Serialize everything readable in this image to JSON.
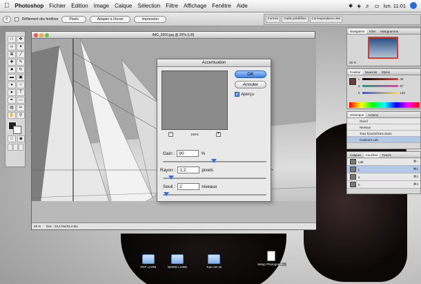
{
  "menubar": {
    "apple": "",
    "app": "Photoshop",
    "items": [
      "Fichier",
      "Edition",
      "Image",
      "Calque",
      "Sélection",
      "Filtre",
      "Affichage",
      "Fenêtre",
      "Aide"
    ],
    "clock": "lun. 11:01"
  },
  "options": {
    "scroll_all": "Défilement des fenêtres",
    "buttons": [
      "Pixels",
      "Adapter à l'écran",
      "Impression"
    ]
  },
  "palette_well": {
    "tabs": [
      "Formes",
      "Outils prédéfinis",
      "Correspondance des"
    ]
  },
  "document": {
    "title": "IMG_5550.jpg @ 25% (L/8)",
    "zoom": "25 %",
    "doc_info": "Doc : 23,4 Mo/23,4 Mo"
  },
  "dialog": {
    "title": "Accentuation",
    "ok": "OK",
    "cancel": "Annuler",
    "preview_check": "✓",
    "preview_label": "Aperçu",
    "preview_zoom": "100%",
    "minus": "−",
    "plus": "+",
    "amount_label": "Gain :",
    "amount_value": "90",
    "amount_unit": "%",
    "radius_label": "Rayon :",
    "radius_value": "1,2",
    "radius_unit": "pixels",
    "threshold_label": "Seuil :",
    "threshold_value": "2",
    "threshold_unit": "niveaux"
  },
  "navigator": {
    "tabs": [
      "Navigateur",
      "Infos",
      "Histogramme"
    ],
    "zoom": "25 %"
  },
  "color_panel": {
    "tabs": [
      "Couleur",
      "Nuancier",
      "Styles"
    ],
    "rows": [
      {
        "label": "L",
        "value": "45"
      },
      {
        "label": "a",
        "value": "87"
      },
      {
        "label": "b",
        "value": "140"
      }
    ]
  },
  "history": {
    "tabs": [
      "Historique",
      "Actions"
    ],
    "items": [
      "Ouvrir",
      "Niveaux",
      "Tons foncés/Tons clairs",
      "Couleurs Lab"
    ]
  },
  "layers": {
    "tabs": [
      "Calques",
      "Couches",
      "Tracés"
    ],
    "items": [
      {
        "name": "Lab",
        "shortcut": "⌘~"
      },
      {
        "name": "L",
        "shortcut": "⌘1"
      },
      {
        "name": "a",
        "shortcut": "⌘2"
      },
      {
        "name": "b",
        "shortcut": "⌘3"
      }
    ]
  },
  "desktop": {
    "icons": [
      "PDF LIVRE",
      "WORD LIVRE",
      "Tuto AD 15",
      "Setup Photograph..."
    ]
  },
  "colors": {
    "accent": "#3f7fe0",
    "selection": "#b3c8e8"
  }
}
